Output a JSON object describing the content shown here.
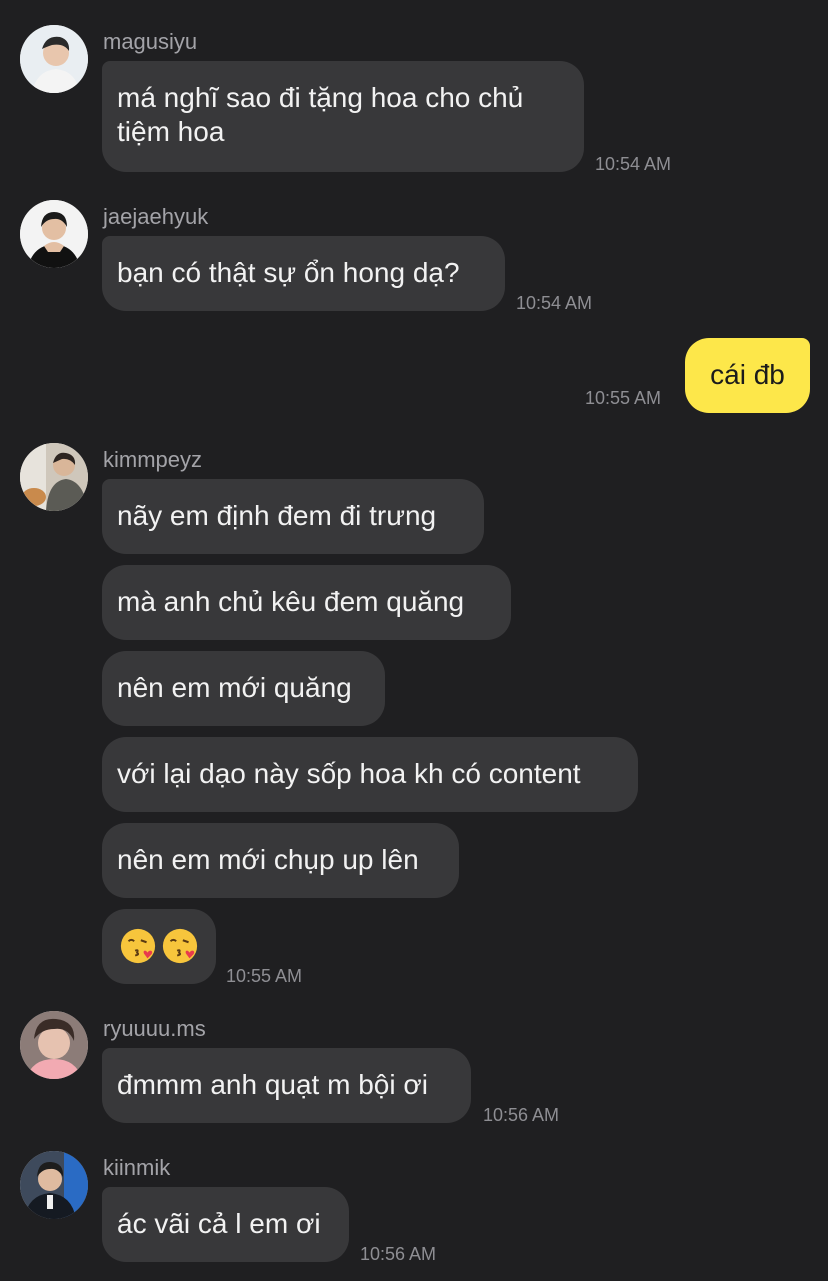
{
  "messages": {
    "m1": {
      "user": "magusiyu",
      "text": "má nghĩ sao đi tặng hoa cho chủ tiệm hoa",
      "time": "10:54 AM"
    },
    "m2": {
      "user": "jaejaehyuk",
      "text": "bạn có thật sự ổn hong dạ?",
      "time": "10:54 AM"
    },
    "m3": {
      "text": "cái đb",
      "time": "10:55 AM"
    },
    "m4": {
      "user": "kimmpeyz",
      "lines": [
        "nãy em định đem đi trưng",
        "mà anh chủ kêu đem quăng",
        "nên em mới quăng",
        "với lại dạo này sốp hoa kh có content",
        "nên em mới chụp up lên"
      ],
      "emoji": [
        "kissing-face-with-heart",
        "kissing-face-with-heart"
      ],
      "time": "10:55 AM"
    },
    "m5": {
      "user": "ryuuuu.ms",
      "text": "đmmm anh quạt m bội ơi",
      "time": "10:56 AM"
    },
    "m6": {
      "user": "kiinmik",
      "text": "ác vãi cả l em ơi",
      "time": "10:56 AM"
    }
  },
  "colors": {
    "background": "#1f1f21",
    "incoming_bubble": "#38383a",
    "outgoing_bubble": "#fde74a",
    "username": "#a3a3a8",
    "timestamp": "#8e8e93"
  }
}
